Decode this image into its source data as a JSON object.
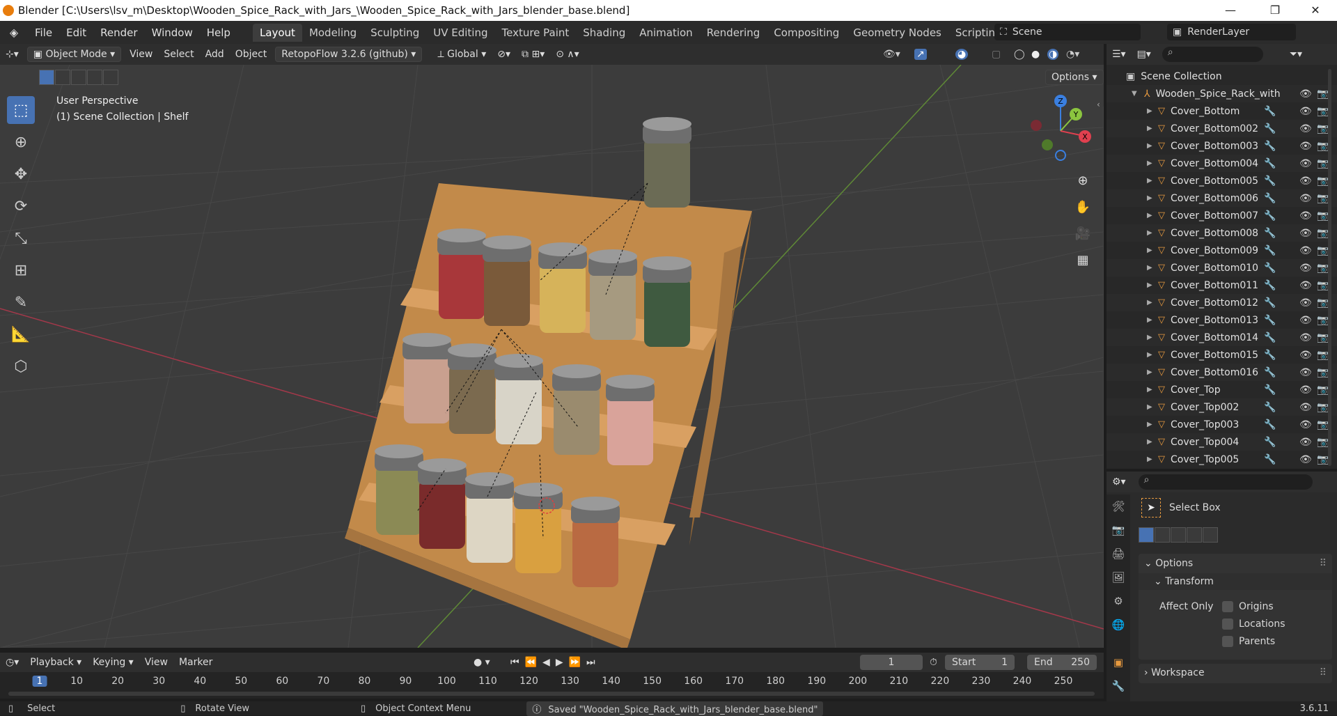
{
  "window": {
    "title": "Blender [C:\\Users\\lsv_m\\Desktop\\Wooden_Spice_Rack_with_Jars_\\Wooden_Spice_Rack_with_Jars_blender_base.blend]",
    "minimize": "—",
    "maximize": "❐",
    "close": "✕"
  },
  "menus": [
    "File",
    "Edit",
    "Render",
    "Window",
    "Help"
  ],
  "workspaces": [
    "Layout",
    "Modeling",
    "Sculpting",
    "UV Editing",
    "Texture Paint",
    "Shading",
    "Animation",
    "Rendering",
    "Compositing",
    "Geometry Nodes",
    "Scripting"
  ],
  "active_workspace": "Layout",
  "scene_name": "Scene",
  "render_layer": "RenderLayer",
  "header3d": {
    "mode": "Object Mode",
    "view": "View",
    "select": "Select",
    "add": "Add",
    "object": "Object",
    "addon": "RetopoFlow 3.2.6 (github)",
    "orientation": "Global",
    "options": "Options"
  },
  "viewport": {
    "perspective": "User Perspective",
    "collection_info": "(1) Scene Collection | Shelf"
  },
  "gizmo": {
    "z": "Z",
    "y": "Y",
    "x": "X"
  },
  "outliner": {
    "root": "Scene Collection",
    "collection": "Wooden_Spice_Rack_with",
    "items": [
      "Cover_Bottom",
      "Cover_Bottom002",
      "Cover_Bottom003",
      "Cover_Bottom004",
      "Cover_Bottom005",
      "Cover_Bottom006",
      "Cover_Bottom007",
      "Cover_Bottom008",
      "Cover_Bottom009",
      "Cover_Bottom010",
      "Cover_Bottom011",
      "Cover_Bottom012",
      "Cover_Bottom013",
      "Cover_Bottom014",
      "Cover_Bottom015",
      "Cover_Bottom016",
      "Cover_Top",
      "Cover_Top002",
      "Cover_Top003",
      "Cover_Top004",
      "Cover_Top005"
    ]
  },
  "properties": {
    "tool_name": "Select Box",
    "options": "Options",
    "transform": "Transform",
    "affect_only": "Affect Only",
    "origins": "Origins",
    "locations": "Locations",
    "parents": "Parents",
    "workspace": "Workspace"
  },
  "timeline": {
    "playback": "Playback",
    "keying": "Keying",
    "view": "View",
    "marker": "Marker",
    "current_frame": "1",
    "start_label": "Start",
    "start": "1",
    "end_label": "End",
    "end": "250",
    "ruler": [
      "1",
      "10",
      "20",
      "30",
      "40",
      "50",
      "60",
      "70",
      "80",
      "90",
      "100",
      "110",
      "120",
      "130",
      "140",
      "150",
      "160",
      "170",
      "180",
      "190",
      "200",
      "210",
      "220",
      "230",
      "240",
      "250"
    ]
  },
  "status": {
    "select": "Select",
    "rotate": "Rotate View",
    "context": "Object Context Menu",
    "message": "Saved \"Wooden_Spice_Rack_with_Jars_blender_base.blend\"",
    "version": "3.6.11"
  },
  "colors": {
    "accent": "#4772b3",
    "axis_x": "#e0404f",
    "axis_y": "#8bc53f",
    "axis_z": "#3a7fe0",
    "mesh": "#e79a3f"
  }
}
